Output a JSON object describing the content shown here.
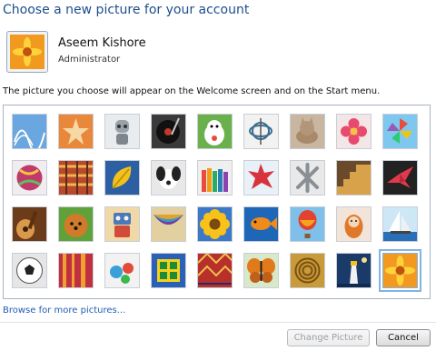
{
  "dialog": {
    "title": "Choose a new picture for your account",
    "description": "The picture you choose will appear on the Welcome screen and on the Start menu."
  },
  "account": {
    "name": "Aseem Kishore",
    "role": "Administrator",
    "picture_icon": "orange-flower-icon"
  },
  "pictures": [
    {
      "icon": "roller-coaster-icon"
    },
    {
      "icon": "starfish-icon"
    },
    {
      "icon": "robot-icon"
    },
    {
      "icon": "record-player-icon"
    },
    {
      "icon": "lucky-cat-icon"
    },
    {
      "icon": "gyroscope-icon"
    },
    {
      "icon": "kitten-icon"
    },
    {
      "icon": "pink-flower-icon"
    },
    {
      "icon": "pinwheel-icon"
    },
    {
      "icon": "beach-ball-icon"
    },
    {
      "icon": "woven-fabric-icon"
    },
    {
      "icon": "yellow-leaf-icon"
    },
    {
      "icon": "puppy-icon"
    },
    {
      "icon": "crayons-icon"
    },
    {
      "icon": "red-leaf-icon"
    },
    {
      "icon": "jacks-icon"
    },
    {
      "icon": "stairs-icon"
    },
    {
      "icon": "origami-crane-icon"
    },
    {
      "icon": "guitar-icon"
    },
    {
      "icon": "pomeranian-icon"
    },
    {
      "icon": "toy-robot-icon"
    },
    {
      "icon": "hammock-icon"
    },
    {
      "icon": "sunflower-icon"
    },
    {
      "icon": "fish-icon"
    },
    {
      "icon": "hot-air-balloon-icon"
    },
    {
      "icon": "doll-icon"
    },
    {
      "icon": "sailboat-icon"
    },
    {
      "icon": "soccer-ball-icon"
    },
    {
      "icon": "striped-fabric-icon"
    },
    {
      "icon": "marbles-icon"
    },
    {
      "icon": "window-icon"
    },
    {
      "icon": "rug-icon"
    },
    {
      "icon": "butterfly-icon"
    },
    {
      "icon": "shell-spiral-icon"
    },
    {
      "icon": "lighthouse-icon"
    },
    {
      "icon": "orange-flower-icon",
      "selected": true
    }
  ],
  "links": {
    "browse": "Browse for more pictures..."
  },
  "buttons": {
    "change": "Change Picture",
    "cancel": "Cancel"
  }
}
